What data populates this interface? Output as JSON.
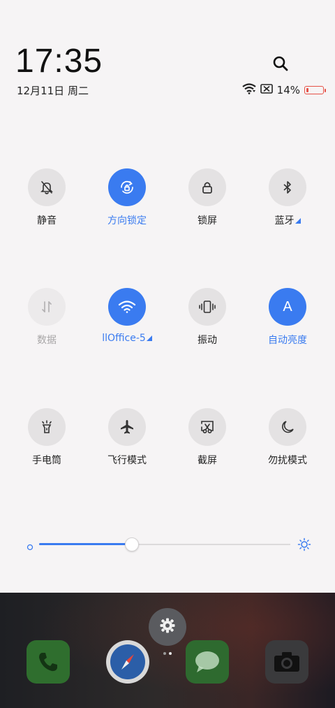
{
  "header": {
    "time": "17:35",
    "date": "12月11日 周二",
    "battery_percent_text": "14%",
    "battery_level": 0.14
  },
  "tiles": [
    {
      "label": "静音",
      "icon": "bell-off-icon",
      "state": "off"
    },
    {
      "label": "方向锁定",
      "icon": "rotation-lock-icon",
      "state": "on"
    },
    {
      "label": "锁屏",
      "icon": "lock-icon",
      "state": "off"
    },
    {
      "label": "蓝牙",
      "icon": "bluetooth-icon",
      "state": "off",
      "expand": true
    },
    {
      "label": "数据",
      "icon": "mobile-data-icon",
      "state": "disabled"
    },
    {
      "label": "llOffice-5",
      "icon": "wifi-icon",
      "state": "on",
      "expand": true
    },
    {
      "label": "振动",
      "icon": "vibrate-icon",
      "state": "off"
    },
    {
      "label": "自动亮度",
      "icon": "auto-brightness-icon",
      "state": "on",
      "glyph": "A"
    },
    {
      "label": "手电筒",
      "icon": "flashlight-icon",
      "state": "off"
    },
    {
      "label": "飞行模式",
      "icon": "airplane-icon",
      "state": "off"
    },
    {
      "label": "截屏",
      "icon": "screenshot-icon",
      "state": "off"
    },
    {
      "label": "勿扰模式",
      "icon": "moon-icon",
      "state": "off"
    }
  ],
  "brightness": {
    "level": 0.37
  },
  "dock": {
    "apps": [
      {
        "name": "phone-app-icon",
        "color": "#2e7d32"
      },
      {
        "name": "browser-app-icon",
        "color": "#2b5ea8"
      },
      {
        "name": "messages-app-icon",
        "color": "#2e7d32"
      },
      {
        "name": "camera-app-icon",
        "color": "#333333"
      }
    ],
    "page_count": 2,
    "active_page": 1
  },
  "colors": {
    "accent": "#3a7bf0",
    "tile_off": "#e4e2e3",
    "battery_low": "#e65147"
  }
}
